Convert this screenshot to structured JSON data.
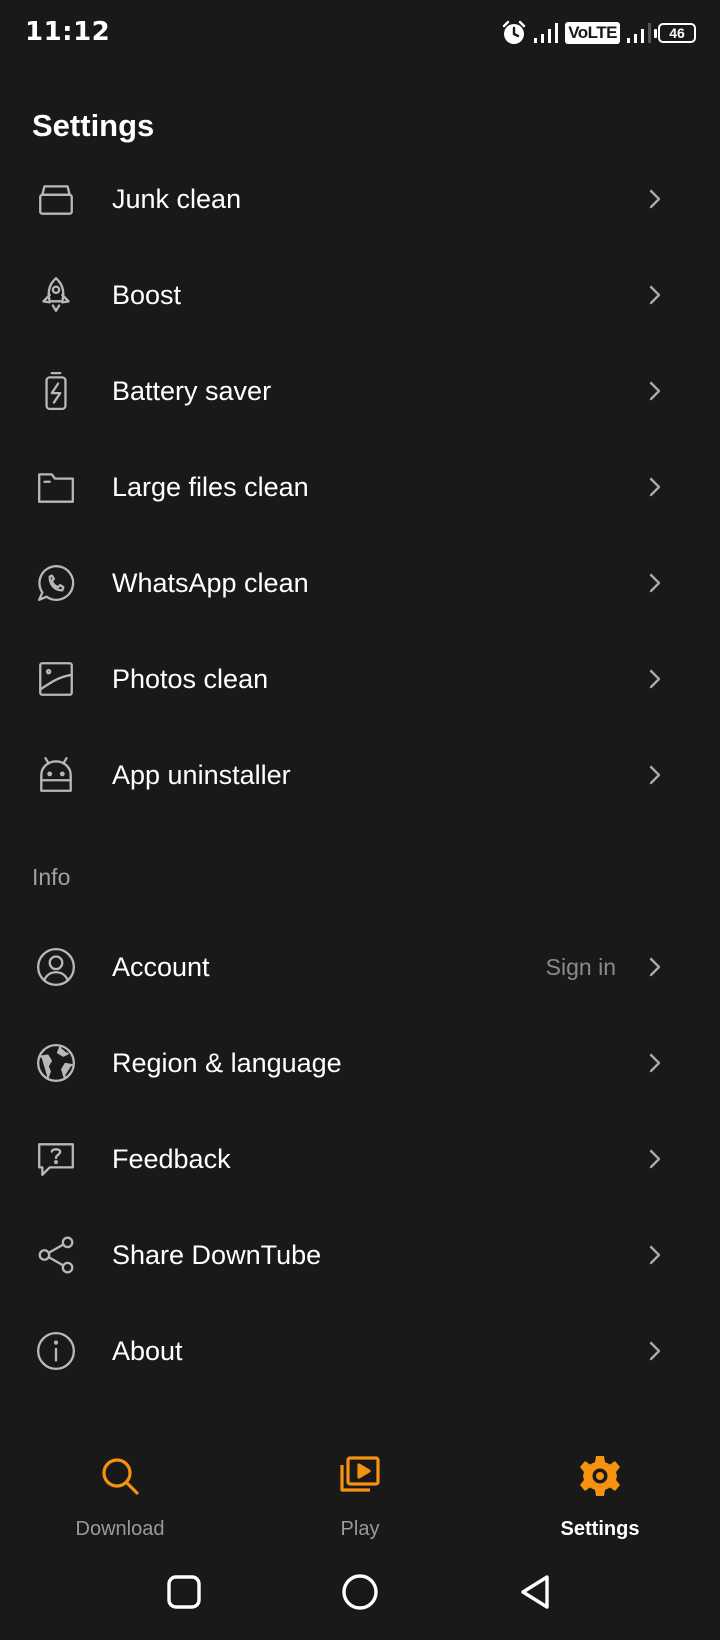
{
  "status_bar": {
    "time": "11:12",
    "network_badge": "VoLTE",
    "battery_level": "46",
    "icons": [
      "alarm-icon",
      "signal-icon",
      "volte-badge",
      "signal-icon",
      "battery-icon"
    ]
  },
  "page": {
    "title": "Settings"
  },
  "tools": [
    {
      "label": "Junk clean",
      "icon": "junk-clean-icon"
    },
    {
      "label": "Boost",
      "icon": "rocket-icon"
    },
    {
      "label": "Battery saver",
      "icon": "battery-charging-icon"
    },
    {
      "label": "Large files clean",
      "icon": "folder-icon"
    },
    {
      "label": "WhatsApp clean",
      "icon": "whatsapp-icon"
    },
    {
      "label": "Photos clean",
      "icon": "photo-icon"
    },
    {
      "label": "App uninstaller",
      "icon": "android-icon"
    }
  ],
  "info_section": {
    "header": "Info",
    "items": [
      {
        "label": "Account",
        "value": "Sign in",
        "icon": "account-icon"
      },
      {
        "label": "Region & language",
        "icon": "globe-icon"
      },
      {
        "label": "Feedback",
        "icon": "feedback-icon"
      },
      {
        "label": "Share DownTube",
        "icon": "share-icon"
      },
      {
        "label": "About",
        "icon": "info-icon"
      }
    ]
  },
  "bottom_nav": {
    "items": [
      {
        "label": "Download",
        "icon": "search-icon",
        "active": false
      },
      {
        "label": "Play",
        "icon": "playlist-icon",
        "active": false
      },
      {
        "label": "Settings",
        "icon": "gear-icon",
        "active": true
      }
    ]
  },
  "colors": {
    "background": "#191919",
    "accent": "#f5920f",
    "text_primary": "#ffffff",
    "text_secondary": "#8a8a8a",
    "icon": "#b8b8b8"
  }
}
